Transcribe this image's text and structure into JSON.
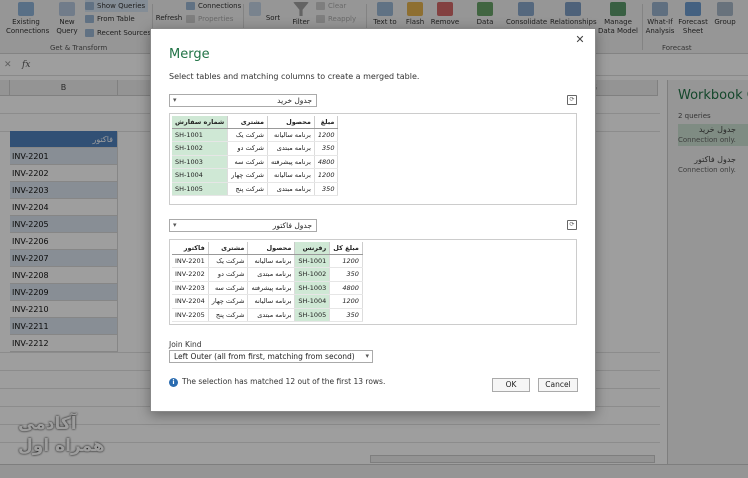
{
  "ribbon": {
    "buttons": [
      {
        "label": "Existing\nConnections",
        "icon": "existing-connections-icon"
      },
      {
        "label": "New\nQuery",
        "icon": "new-query-icon"
      },
      {
        "label": "Refresh",
        "icon": "refresh-icon"
      },
      {
        "label": "Sort",
        "icon": "sort-icon"
      },
      {
        "label": "Filter",
        "icon": "filter-icon"
      },
      {
        "label": "Text to",
        "icon": "text-to-columns-icon"
      },
      {
        "label": "Flash",
        "icon": "flash-fill-icon"
      },
      {
        "label": "Remove",
        "icon": "remove-duplicates-icon"
      },
      {
        "label": "Data",
        "icon": "data-validation-icon"
      },
      {
        "label": "Consolidate",
        "icon": "consolidate-icon"
      },
      {
        "label": "Relationships",
        "icon": "relationships-icon"
      },
      {
        "label": "Manage\nData Model",
        "icon": "data-model-icon"
      },
      {
        "label": "What-If\nAnalysis",
        "icon": "what-if-icon"
      },
      {
        "label": "Forecast\nSheet",
        "icon": "forecast-icon"
      },
      {
        "label": "Group",
        "icon": "group-icon"
      }
    ],
    "show_queries": "Show Queries",
    "from_table": "From Table",
    "recent_sources": "Recent Sources",
    "connections": "Connections",
    "properties": "Properties",
    "clear": "Clear",
    "reapply": "Reapply",
    "group_get_transform": "Get & Transform",
    "group_forecast": "Forecast"
  },
  "formula": {
    "cancel": "✕",
    "fx": "fx"
  },
  "sheet": {
    "column_b": "B",
    "column_g": "G",
    "header_cell": "فاکتور",
    "rows": [
      "INV-2201",
      "INV-2202",
      "INV-2203",
      "INV-2204",
      "INV-2205",
      "INV-2206",
      "INV-2207",
      "INV-2208",
      "INV-2209",
      "INV-2210",
      "INV-2211",
      "INV-2212"
    ]
  },
  "pane": {
    "title": "Workbook Queries",
    "count": "2 queries",
    "queries": [
      {
        "name": "جدول خرید",
        "status": "Connection only."
      },
      {
        "name": "جدول فاکتور",
        "status": "Connection only."
      }
    ]
  },
  "dialog": {
    "title": "Merge",
    "description": "Select tables and matching columns to create a merged table.",
    "close": "✕",
    "table1_select": "جدول خرید",
    "table1": {
      "headers": [
        "شماره سفارش",
        "مشتری",
        "محصول",
        "مبلغ"
      ],
      "rows": [
        [
          "SH-1001",
          "شرکت یک",
          "برنامه سالیانه",
          "1200"
        ],
        [
          "SH-1002",
          "شرکت دو",
          "برنامه مبتدی",
          "350"
        ],
        [
          "SH-1003",
          "شرکت سه",
          "برنامه پیشرفته",
          "4800"
        ],
        [
          "SH-1004",
          "شرکت چهار",
          "برنامه سالیانه",
          "1200"
        ],
        [
          "SH-1005",
          "شرکت پنج",
          "برنامه مبتدی",
          "350"
        ]
      ]
    },
    "table2_select": "جدول فاکتور",
    "table2": {
      "headers": [
        "فاکتور",
        "مشتری",
        "محصول",
        "رفرنس",
        "مبلغ کل"
      ],
      "rows": [
        [
          "INV-2201",
          "شرکت یک",
          "برنامه سالیانه",
          "SH-1001",
          "1200"
        ],
        [
          "INV-2202",
          "شرکت دو",
          "برنامه مبتدی",
          "SH-1002",
          "350"
        ],
        [
          "INV-2203",
          "شرکت سه",
          "برنامه پیشرفته",
          "SH-1003",
          "4800"
        ],
        [
          "INV-2204",
          "شرکت چهار",
          "برنامه سالیانه",
          "SH-1004",
          "1200"
        ],
        [
          "INV-2205",
          "شرکت پنج",
          "برنامه مبتدی",
          "SH-1005",
          "350"
        ]
      ]
    },
    "join_kind_label": "Join Kind",
    "join_kind_value": "Left Outer (all from first, matching from second)",
    "match_info": "The selection has matched 12 out of the first 13 rows.",
    "ok": "OK",
    "cancel": "Cancel"
  },
  "watermark": {
    "line1": "آکادمی",
    "line2": "همراه اول"
  },
  "colors": {
    "accent": "#217346",
    "table_header": "#4f81bd",
    "band": "#dce6f1",
    "highlight": "#cfe8d5"
  }
}
